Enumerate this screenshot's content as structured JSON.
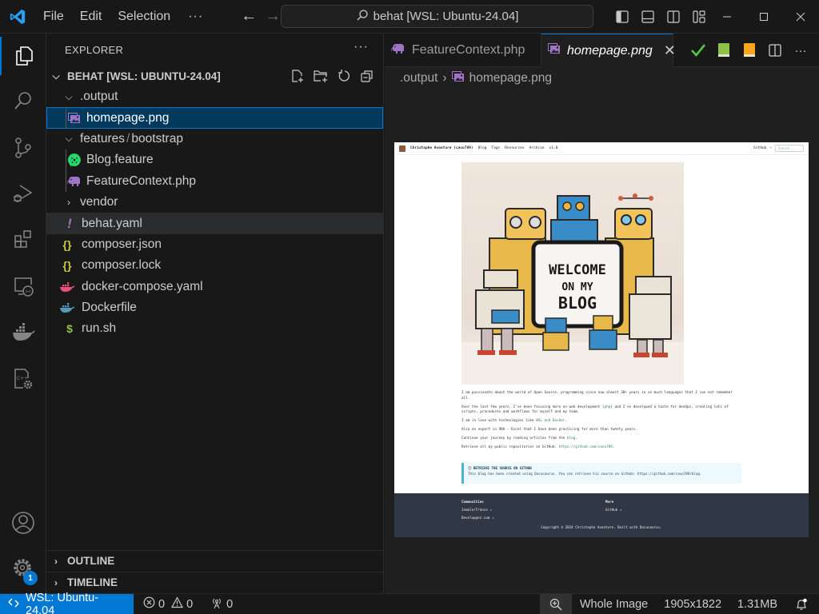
{
  "titlebar": {
    "menu": [
      "File",
      "Edit",
      "Selection"
    ],
    "more": "···",
    "command_center": "behat [WSL: Ubuntu-24.04]"
  },
  "explorer": {
    "title": "EXPLORER",
    "more": "···",
    "folder": "BEHAT [WSL: UBUNTU-24.04]",
    "items": [
      {
        "label": ".output",
        "type": "folder",
        "expanded": true,
        "depth": 1
      },
      {
        "label": "homepage.png",
        "type": "image",
        "depth": 2,
        "selected": true
      },
      {
        "label": "features",
        "label2": "bootstrap",
        "sep": "/",
        "type": "folder",
        "expanded": true,
        "depth": 1
      },
      {
        "label": "Blog.feature",
        "type": "cucumber",
        "depth": 2
      },
      {
        "label": "FeatureContext.php",
        "type": "php",
        "depth": 2
      },
      {
        "label": "vendor",
        "type": "folder",
        "expanded": false,
        "depth": 1
      },
      {
        "label": "behat.yaml",
        "type": "yaml",
        "depth": 1,
        "hover": true
      },
      {
        "label": "composer.json",
        "type": "json",
        "depth": 1
      },
      {
        "label": "composer.lock",
        "type": "json",
        "depth": 1
      },
      {
        "label": "docker-compose.yaml",
        "type": "docker-compose",
        "depth": 1
      },
      {
        "label": "Dockerfile",
        "type": "docker",
        "depth": 1
      },
      {
        "label": "run.sh",
        "type": "shell",
        "depth": 1
      }
    ],
    "outline": "OUTLINE",
    "timeline": "TIMELINE"
  },
  "activity_bar": {
    "items": [
      "explorer-icon",
      "search-icon",
      "source-control-icon",
      "run-debug-icon",
      "extensions-icon",
      "remote-explorer-icon",
      "docker-icon",
      "cpp-settings-icon"
    ],
    "settings_badge": "1"
  },
  "editor": {
    "tabs": [
      {
        "label": "FeatureContext.php",
        "active": false
      },
      {
        "label": "homepage.png",
        "active": true,
        "close": "✕"
      }
    ],
    "breadcrumb": [
      ".output",
      "homepage.png"
    ],
    "breadcrumb_sep": "›"
  },
  "preview": {
    "nav": {
      "brand": "Christophe Avonture (cavo789)",
      "links": [
        "Blog",
        "Tags",
        "Resources",
        "Archive",
        "v1.0"
      ],
      "github": "GitHub",
      "search_placeholder": "Search..."
    },
    "hero_sign": [
      "WELCOME",
      "ON MY",
      "BLOG"
    ],
    "paragraphs": [
      {
        "pre": "I am passionate about the world of Open Source, programming since now almost 30+ years in so much languages that I can not remember all.",
        "link": "",
        "post": ""
      },
      {
        "pre": "Over the last few years, I've been focusing more on web development (",
        "link": "php",
        "post": ") and I've developed a taste for devOps, creating lots of scripts, procedures and workflows for myself and my team."
      },
      {
        "pre": "I am in love with technologies like ",
        "link": "WSL and Docker",
        "post": "."
      },
      {
        "pre": "Also an expert in VBA - Excel that I have been practicing for more than twenty years.",
        "link": "",
        "post": ""
      },
      {
        "pre": "Continue your journey by reading articles from the ",
        "link": "blog",
        "post": "."
      },
      {
        "pre": "Retrieve all my public repositories on GitHub: ",
        "link": "https://github.com/cavo789",
        "post": "."
      }
    ],
    "admonition": {
      "title": "ⓘ RETRIEVE THE SOURCE ON GITHUB",
      "text": "This blog has been created using Docusaurus. You can retrieve his source on GitHub: https://github.com/cavo789/blog."
    },
    "footer": {
      "col1_title": "Communities",
      "col1_links": [
        "Joomla!France ↗",
        "Developpez.com ↗"
      ],
      "col2_title": "More",
      "col2_links": [
        "GitHub ↗"
      ],
      "copyright": "Copyright © 2024 Christophe Avonture. Built with Docusaurus."
    }
  },
  "statusbar": {
    "remote": "WSL: Ubuntu-24.04",
    "errors": "0",
    "warnings": "0",
    "ports": "0",
    "zoom_mode": "Whole Image",
    "dimensions": "1905x1822",
    "file_size": "1.31MB"
  },
  "colors": {
    "accent": "#0078d4",
    "selection": "#04395e",
    "php": "#a074c4",
    "image": "#a074c4",
    "cucumber": "#23d96c",
    "json": "#cbcb41",
    "yaml": "#a074c4",
    "docker_compose": "#e9507a",
    "docker": "#519aba",
    "shell": "#8dc149",
    "check": "#4ec941",
    "book_green": "#8dc149",
    "book_orange": "#f5a623"
  }
}
